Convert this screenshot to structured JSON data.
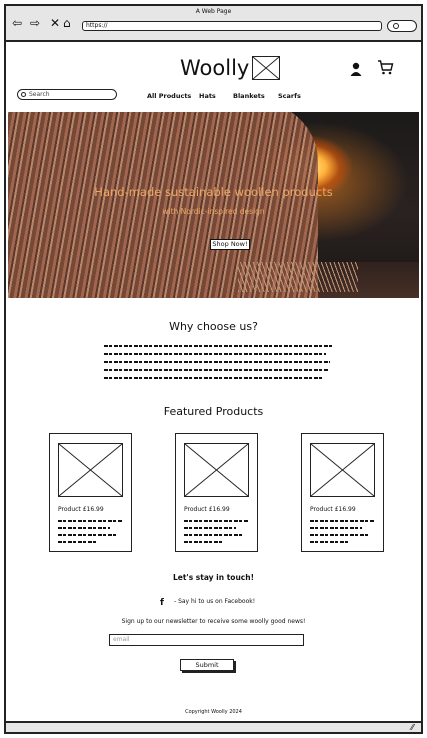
{
  "browser": {
    "window_title": "A Web Page",
    "url": "https://",
    "back_icon": "arrow-left-icon",
    "forward_icon": "arrow-right-icon",
    "close_icon": "x-icon",
    "home_icon": "home-icon",
    "search_icon": "search-icon"
  },
  "header": {
    "logo_text": "Woolly",
    "logo_image": "image-placeholder",
    "account_icon": "user-icon",
    "cart_icon": "cart-icon"
  },
  "search": {
    "placeholder": "Search"
  },
  "nav": {
    "items": [
      "All Products",
      "Hats",
      "Blankets",
      "Scarfs"
    ]
  },
  "hero": {
    "title": "Hand-made sustainable woollen products",
    "subtitle": "with Nordic-inspired design",
    "cta": "Shop Now!"
  },
  "why": {
    "heading": "Why choose us?"
  },
  "featured": {
    "heading": "Featured Products",
    "products": [
      {
        "price": "Product £16.99"
      },
      {
        "price": "Product £16.99"
      },
      {
        "price": "Product £16.99"
      }
    ]
  },
  "newsletter": {
    "heading": "Let's stay in touch!",
    "facebook_icon": "f",
    "facebook_text": "- Say hi to us on Facebook!",
    "signup_text": "Sign up to our newsletter to receive some woolly good news!",
    "email_placeholder": "email",
    "submit_label": "Submit"
  },
  "footer": {
    "copyright": "Copyright Woolly 2024"
  },
  "colors": {
    "hero_text": "#e9a867",
    "chrome": "#e6e6e6"
  }
}
